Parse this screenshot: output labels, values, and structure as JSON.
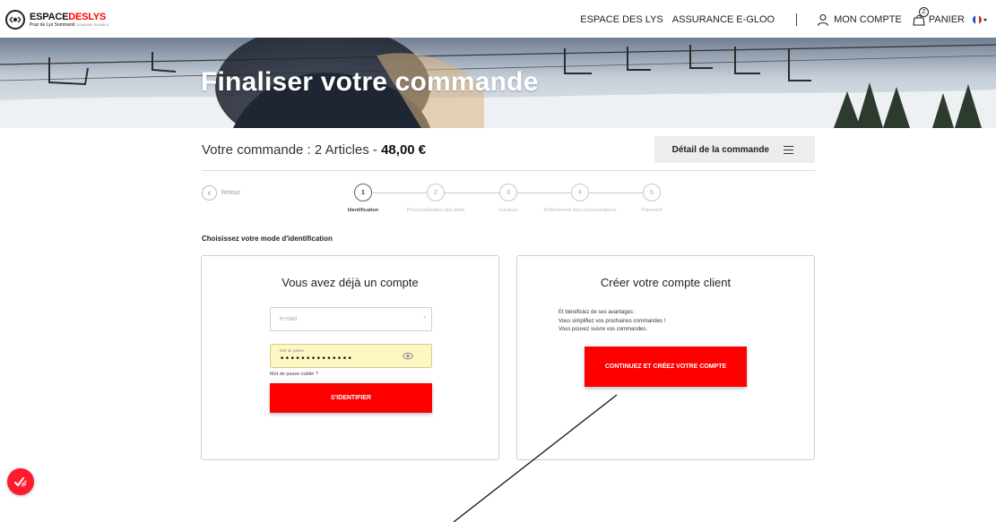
{
  "header": {
    "logo": {
      "main_a": "ESPACE",
      "main_b": "DESLYS",
      "sub": "Praz de Lys Sommand",
      "sub_small": "DOMAINE SKIABLE"
    },
    "nav": {
      "espace": "ESPACE DES LYS",
      "assurance": "ASSURANCE E-GLOO",
      "account": "MON COMPTE",
      "cart": "PANIER",
      "cart_count": "2"
    }
  },
  "banner": {
    "title": "Finaliser votre commande"
  },
  "order": {
    "summary_prefix": "Votre commande : 2 Articles - ",
    "total": "48,00 €",
    "detail_label": "Détail de la commande"
  },
  "stepper": {
    "back_label": "Retour",
    "steps": [
      {
        "num": "1",
        "label": "Identification"
      },
      {
        "num": "2",
        "label": "Personnalisation des titres"
      },
      {
        "num": "3",
        "label": "Livraison"
      },
      {
        "num": "4",
        "label": "Prélèvement des consommations"
      },
      {
        "num": "5",
        "label": "Paiement"
      }
    ]
  },
  "identification": {
    "section_title": "Choisissez votre mode d'identification",
    "login": {
      "title": "Vous avez déjà un compte",
      "email_placeholder": "e-mail",
      "required_mark": "*",
      "password_label": "Mot de passe",
      "password_value": "••••••••••••••",
      "forgot": "Mot de passe oublié ?",
      "submit": "S'IDENTIFIER"
    },
    "create": {
      "title": "Créer votre compte client",
      "benefits": [
        "Et bénéficiez de ses avantages :",
        "Vous simplifiez vos prochaines commandes !",
        "Vous pouvez suivre vos commandes."
      ],
      "button": "CONTINUEZ ET CRÉEZ VOTRE COMPTE"
    }
  },
  "colors": {
    "accent": "#ff0000",
    "autofill": "#fdf7c3",
    "detail_bg": "#ededed"
  },
  "icons": [
    "user-icon",
    "bag-icon",
    "flag-fr-icon",
    "list-icon",
    "eye-icon",
    "chevron-left-icon",
    "chat-badge-icon"
  ]
}
